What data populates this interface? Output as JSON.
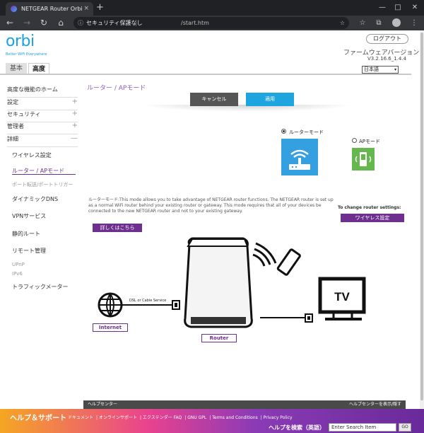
{
  "browser": {
    "tab_title": "NETGEAR Router Orbi",
    "security_label": "セキュリティ保護なし",
    "url": "/start.htm",
    "tab_close": "×",
    "new_tab": "+",
    "win_min": "—",
    "win_max": "□",
    "win_close": "✕",
    "back": "←",
    "forward": "→",
    "reload": "↻",
    "home": "⌂",
    "info_glyph": "ⓘ",
    "star_glyph": "☆",
    "ext1": "☆",
    "ext2": "⧉",
    "menu_glyph": "⋮"
  },
  "header": {
    "logo": "orbi",
    "tagline": "Better WiFi Everywhere",
    "logout": "ログアウト",
    "firmware_label": "ファームウェアバージョン",
    "firmware_version": "V3.2.16.6_1.4.4",
    "language": "日本語",
    "lang_arrow": "▾"
  },
  "tabs": {
    "basic": "基本",
    "advanced": "高度"
  },
  "sidebar": {
    "top_items": [
      {
        "label": "高度な機能のホーム",
        "marker": ""
      },
      {
        "label": "設定",
        "marker": "+"
      },
      {
        "label": "セキュリティ",
        "marker": "+"
      },
      {
        "label": "管理者",
        "marker": "+"
      },
      {
        "label": "詳細",
        "marker": "—"
      }
    ],
    "sub_items": [
      "ワイヤレス設定",
      "ルーター / APモード",
      "ポート転送/ポートトリガー",
      "ダイナミックDNS",
      "VPNサービス",
      "静的ルート",
      "リモート管理",
      "UPnP",
      "IPv6",
      "トラフィックメーター"
    ]
  },
  "main": {
    "title": "ルーター / APモード",
    "cancel": "キャンセル",
    "apply": "適用",
    "router_mode": "ルーターモード",
    "ap_mode": "APモード",
    "description_term": "ルーターモード:",
    "description": "This mode allows you to take advantage of NETGEAR router functions. The NETGEAR router is set up as a normal WiFi router behind your existing router or gateway. This mode requires that all of your devices be connected to the new NETGEAR router and not to your existing gateway.",
    "learn_more": "詳しくはこちら",
    "change_settings_label": "To change router settings:",
    "wireless_button": "ワイヤレス設定",
    "router_mode_selected": true
  },
  "diagram": {
    "internet": "Internet",
    "router": "Router",
    "dsl": "DSL or Cable Service",
    "tv": "TV"
  },
  "helpbar": {
    "left": "ヘルプセンター",
    "right": "ヘルプセンターを表示/隠す"
  },
  "footer": {
    "title": "ヘルプ＆サポート",
    "links": [
      "ドキュメント",
      "オンラインサポート",
      "エクステンダー FAQ",
      "GNU GPL",
      "Terms and Conditions",
      "Privacy Policy"
    ],
    "search_label": "ヘルプを検索（英語）",
    "search_placeholder": "Enter Search Item",
    "go": "GO"
  },
  "colors": {
    "accent_purple": "#6e2f8e",
    "accent_blue": "#1ea5e0",
    "ap_green": "#66b84e"
  }
}
